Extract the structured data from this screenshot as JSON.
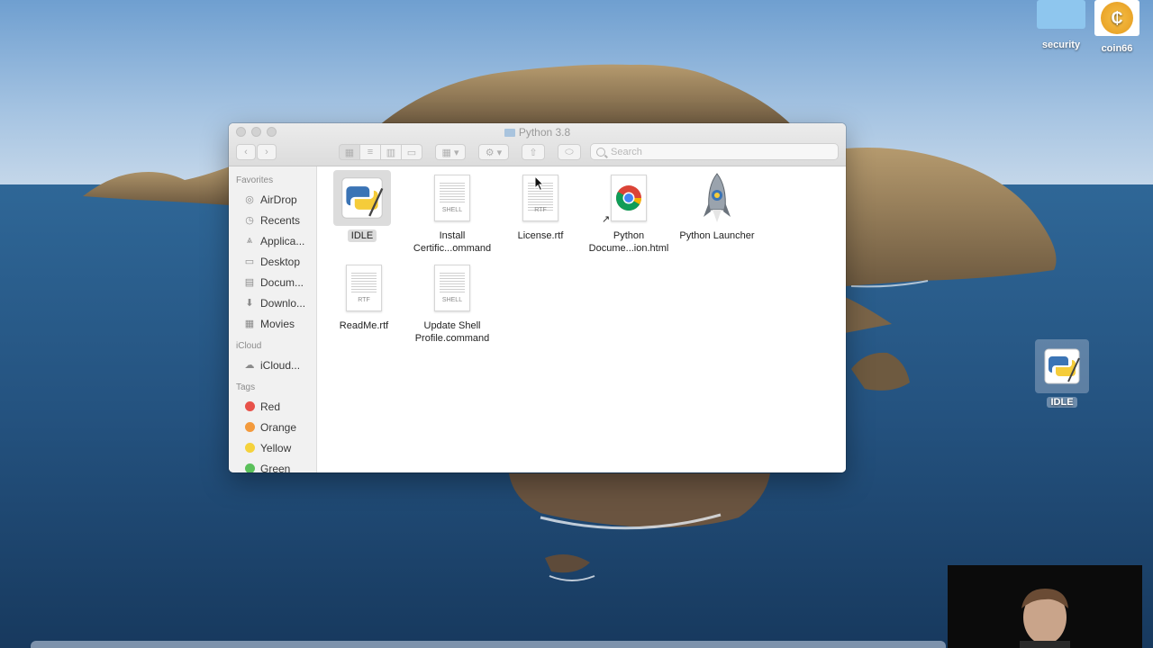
{
  "desktop": {
    "icons": [
      {
        "label": "security"
      },
      {
        "label": "coin66"
      },
      {
        "label": "IDLE"
      }
    ]
  },
  "window": {
    "title": "Python 3.8",
    "search_placeholder": "Search"
  },
  "sidebar": {
    "favorites_header": "Favorites",
    "favorites": [
      {
        "label": "AirDrop",
        "icon": "airdrop-icon"
      },
      {
        "label": "Recents",
        "icon": "clock-icon"
      },
      {
        "label": "Applica...",
        "icon": "applications-icon"
      },
      {
        "label": "Desktop",
        "icon": "desktop-icon"
      },
      {
        "label": "Docum...",
        "icon": "document-icon"
      },
      {
        "label": "Downlo...",
        "icon": "download-icon"
      },
      {
        "label": "Movies",
        "icon": "film-icon"
      }
    ],
    "icloud_header": "iCloud",
    "icloud": [
      {
        "label": "iCloud...",
        "icon": "cloud-icon"
      }
    ],
    "tags_header": "Tags",
    "tags": [
      {
        "label": "Red",
        "color": "#e8524a"
      },
      {
        "label": "Orange",
        "color": "#f39a3c"
      },
      {
        "label": "Yellow",
        "color": "#f5d23c"
      },
      {
        "label": "Green",
        "color": "#5ac05a"
      }
    ]
  },
  "files": [
    {
      "name": "IDLE",
      "kind": "app-idle",
      "selected": true
    },
    {
      "name": "Install Certific...ommand",
      "kind": "shell",
      "tag": "SHELL"
    },
    {
      "name": "License.rtf",
      "kind": "rtf",
      "tag": "RTF"
    },
    {
      "name": "Python Docume...ion.html",
      "kind": "chrome-html"
    },
    {
      "name": "Python Launcher",
      "kind": "rocket-app"
    },
    {
      "name": "ReadMe.rtf",
      "kind": "rtf",
      "tag": "RTF"
    },
    {
      "name": "Update Shell Profile.command",
      "kind": "shell",
      "tag": "SHELL"
    }
  ]
}
